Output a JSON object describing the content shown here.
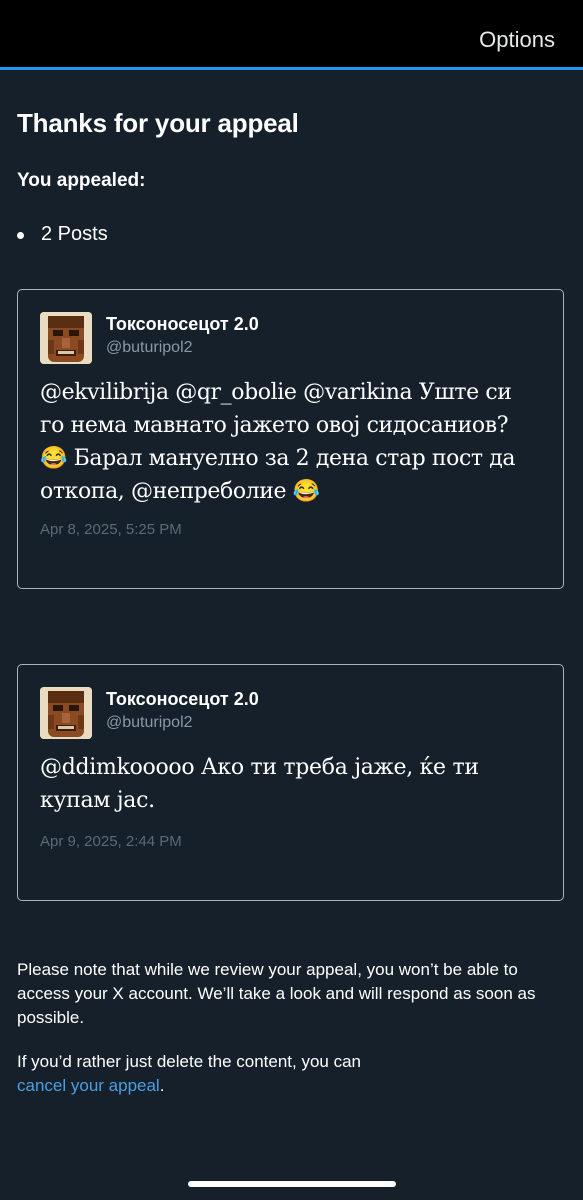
{
  "header": {
    "options_label": "Options"
  },
  "appeal": {
    "title": "Thanks for your appeal",
    "subtitle": "You appealed:",
    "count_item": "2 Posts"
  },
  "posts": [
    {
      "author": "Токсоносецот 2.0",
      "handle": "@buturipol2",
      "text": "@ekvilibrija @qr_obolie @varikina Уште си го нема мавнато јажето овој сидосаниов? 😂 Барал мануелно за 2 дена стар пост да откопа, @непреболие 😂",
      "date": "Apr 8, 2025, 5:25 PM"
    },
    {
      "author": "Токсоносецот 2.0",
      "handle": "@buturipol2",
      "text": "@ddimkooooo Ако ти треба јаже, ќе ти купам јас.",
      "date": "Apr 9, 2025, 2:44 PM"
    }
  ],
  "footer": {
    "note": "Please note that while we review your appeal, you won’t be able to access your X account. We’ll take a look and will respond as soon as possible.",
    "delete_prefix": "If you’d rather just delete the content, you can",
    "cancel_link": "cancel your appeal",
    "delete_suffix": "."
  },
  "colors": {
    "background": "#15202b",
    "accent": "#1d9bf0",
    "link": "#4a9fe0",
    "muted": "#8b98a5"
  }
}
